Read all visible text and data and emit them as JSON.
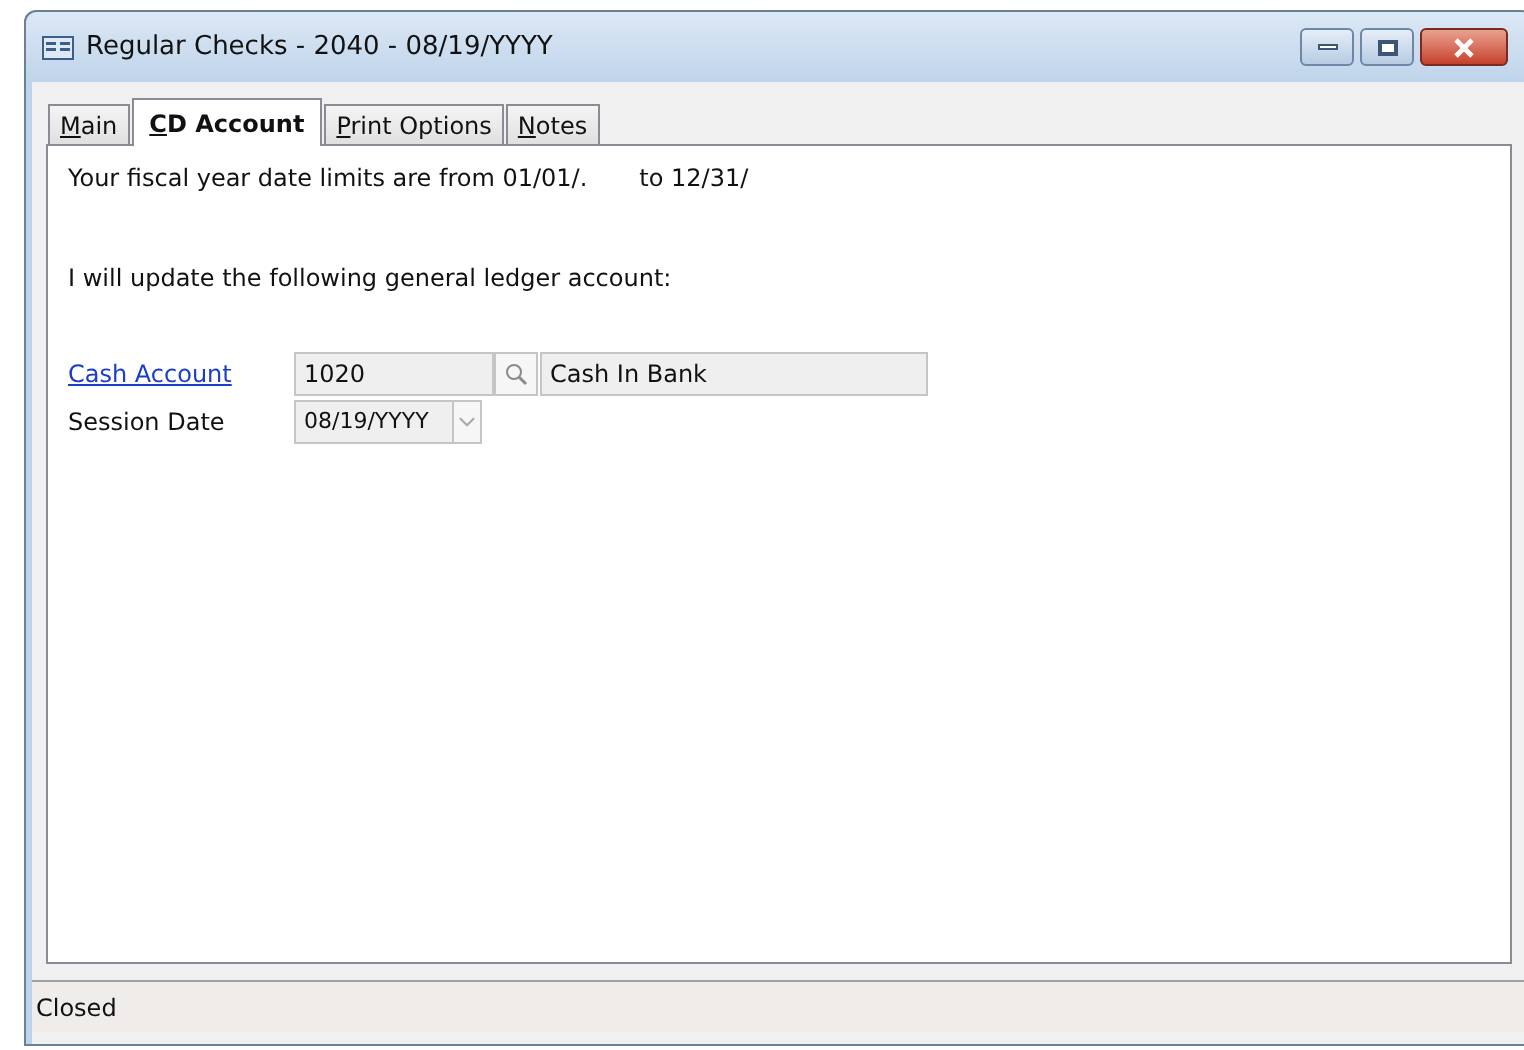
{
  "window": {
    "title": "Regular Checks - 2040 - 08/19/YYYY"
  },
  "tabs": [
    {
      "label": "Main",
      "selected": false
    },
    {
      "label": "CD Account",
      "selected": true
    },
    {
      "label": "Print Options",
      "selected": false
    },
    {
      "label": "Notes",
      "selected": false
    }
  ],
  "fiscal": {
    "from_text": "Your fiscal year date limits are from 01/01/.",
    "to_text": "to 12/31/"
  },
  "update_text": "I will update the following general ledger account:",
  "cash_account": {
    "label": "Cash Account",
    "value": "1020",
    "description": "Cash In Bank"
  },
  "session_date": {
    "label": "Session Date",
    "value": "08/19/YYYY"
  },
  "status_bar": "Closed"
}
